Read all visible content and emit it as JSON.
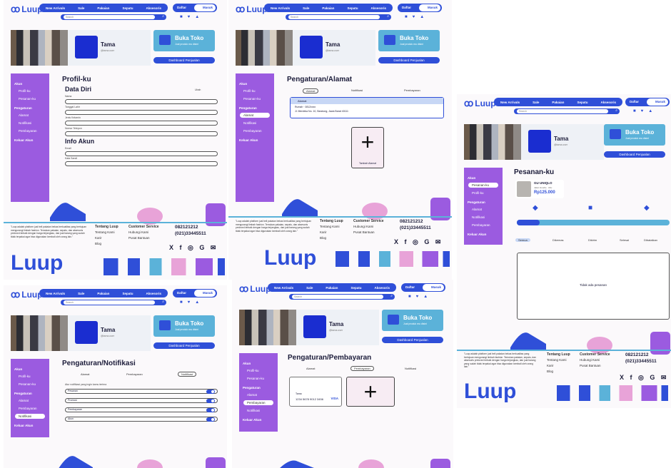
{
  "brand": {
    "name": "Luup",
    "accent": "#2f4fd8",
    "purple": "#9b5be0",
    "cyan": "#5bb2d9"
  },
  "nav": [
    "New Arrivals",
    "Sale",
    "Pakaian",
    "Sepatu",
    "Aksesoris"
  ],
  "auth": {
    "daftar": "Daftar",
    "masuk": "Masuk"
  },
  "search": {
    "placeholder": "Search"
  },
  "profile": {
    "name": "Tama",
    "sub": "@tama.user"
  },
  "shop": {
    "title": "Buka Toko",
    "sub": "Jual produk mu disini",
    "dashboard": "Dashboard Penjualan"
  },
  "sidebar": {
    "akun": "Akun",
    "profilku": "Profil-ku",
    "alamat": "Alamat",
    "pengaturan": "Pengaturan",
    "pesanan": "Pesanan-ku",
    "notifikasi": "Notifikasi",
    "pembayaran": "Pembayaran",
    "keluar": "Keluar Akun"
  },
  "profil": {
    "title": "Profil-ku",
    "data_diri": "Data Diri",
    "info_akun": "Info Akun",
    "ubah": "Ubah",
    "fields": [
      "Nama",
      "Tanggal Lahir",
      "Jenis Kelamin",
      "Nomor Telepon",
      "Email",
      "Kata Sandi"
    ]
  },
  "alamat": {
    "title": "Pengaturan/Alamat",
    "tabs": [
      "Alamat",
      "Notifikasi",
      "Pembayaran"
    ],
    "card_title": "Alamat",
    "card_line1": "Rumah · 0812xxxx",
    "card_line2": "Jl. Merdeka No. 10, Bandung, Jawa Barat 40111",
    "plus": "+",
    "add": "Tambah Alamat"
  },
  "notifikasi": {
    "title": "Pengaturan/Notifikasi",
    "tabs": [
      "Alamat",
      "Pembayaran",
      "Notifikasi"
    ],
    "heading": "Atur notifikasi yang ingin kamu terima",
    "rows": [
      "Pesanan",
      "Promosi",
      "Pembayaran",
      "Akun"
    ]
  },
  "pembayaran": {
    "title": "Pengaturan/Pembayaran",
    "tabs": [
      "Alamat",
      "Pembayaran",
      "Notifikasi"
    ],
    "card_name": "Tama",
    "card_num": "1234 5678 9012 3456",
    "card_brand": "VISA",
    "plus": "+"
  },
  "pesanan": {
    "title": "Pesanan-ku",
    "product": "GU UNIQLO",
    "variant": "Jaket Hoodie · Abu",
    "price": "Rp125.000",
    "tabs": [
      "Semua",
      "Dikemas",
      "Dikirim",
      "Selesai",
      "Dibatalkan"
    ],
    "empty": "Tidak ada pesanan"
  },
  "footer": {
    "about": "\"Luup adalah platform jual beli pakaian bekas berkualitas yang bertujuan mengurangi limbah fashion. Temukan pakaian, sepatu, dan aksesoris preloved terbaik dengan harga terjangkau, dan jual barang yang sudah tidak terpakai agar bisa digunakan kembali oleh orang lain.\"",
    "tentang": "Tentang Luup",
    "tentang_items": [
      "Tentang Kami",
      "Karir",
      "Blog"
    ],
    "cs": "Customer Service",
    "cs_items": [
      "Hubungi Kami",
      "Pusat Bantuan"
    ],
    "phone1": "082121212",
    "phone2": "(021)33445511",
    "social": "X f ◎ G ✉"
  }
}
